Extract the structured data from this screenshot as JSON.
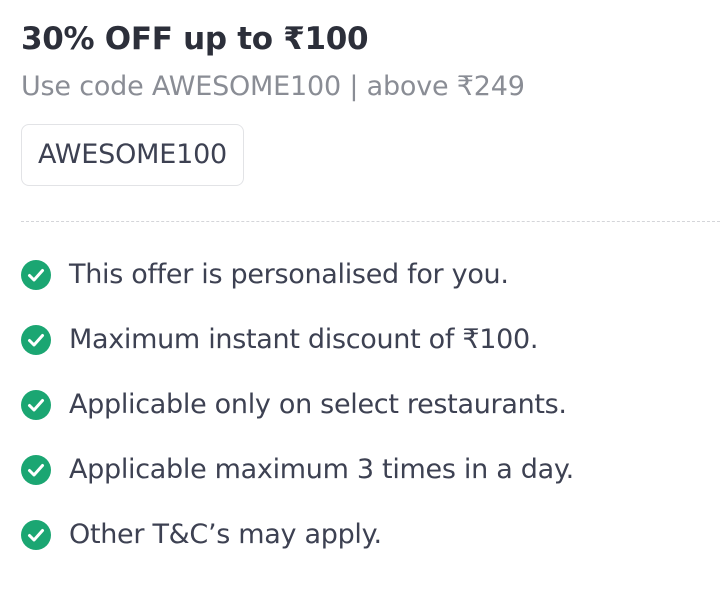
{
  "offer": {
    "title": "30% OFF up to ₹100",
    "subtitle": "Use code AWESOME100 | above ₹249",
    "coupon_code": "AWESOME100"
  },
  "terms": {
    "icon": "check-circle-icon",
    "icon_color": "#1ba672",
    "items": [
      {
        "text": "This offer is personalised for you."
      },
      {
        "text": "Maximum instant discount of ₹100."
      },
      {
        "text": "Applicable only on select restaurants."
      },
      {
        "text": "Applicable maximum 3 times in a day."
      },
      {
        "text": "Other T&C’s may apply."
      }
    ]
  }
}
